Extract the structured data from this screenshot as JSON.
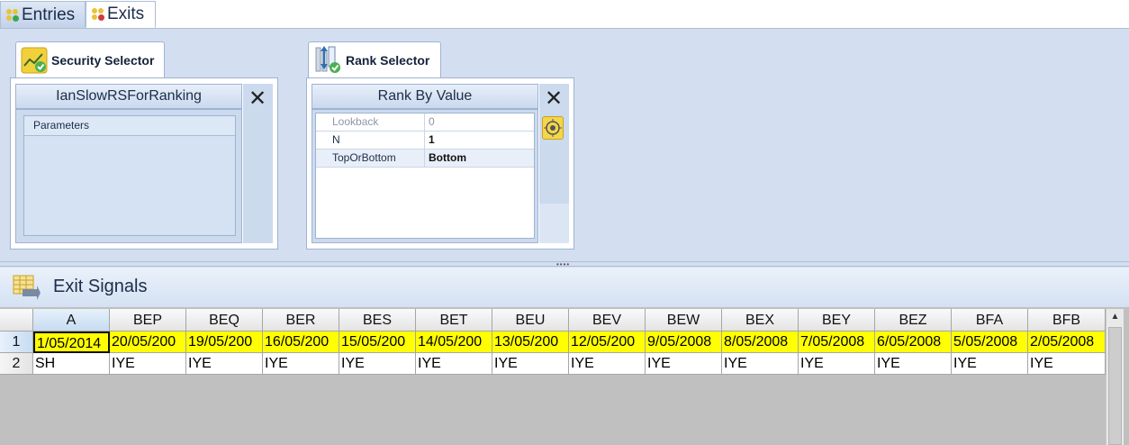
{
  "top_tabs": [
    {
      "label": "Entries"
    },
    {
      "label": "Exits"
    }
  ],
  "security_selector": {
    "tab_label": "Security Selector",
    "header": "IanSlowRSForRanking",
    "params_title": "Parameters"
  },
  "rank_selector": {
    "tab_label": "Rank Selector",
    "header": "Rank By Value",
    "params": [
      {
        "name": "Lookback",
        "value": "0"
      },
      {
        "name": "N",
        "value": "1"
      },
      {
        "name": "TopOrBottom",
        "value": "Bottom"
      }
    ]
  },
  "exit_signals": {
    "title": "Exit Signals"
  },
  "sheet": {
    "columns": [
      "A",
      "BEP",
      "BEQ",
      "BER",
      "BES",
      "BET",
      "BEU",
      "BEV",
      "BEW",
      "BEX",
      "BEY",
      "BEZ",
      "BFA",
      "BFB"
    ],
    "rows": [
      {
        "num": "1",
        "cells": [
          "1/05/2014",
          "20/05/200",
          "19/05/200",
          "16/05/200",
          "15/05/200",
          "14/05/200",
          "13/05/200",
          "12/05/200",
          "9/05/2008",
          "8/05/2008",
          "7/05/2008",
          "6/05/2008",
          "5/05/2008",
          "2/05/2008"
        ]
      },
      {
        "num": "2",
        "cells": [
          "SH",
          "IYE",
          "IYE",
          "IYE",
          "IYE",
          "IYE",
          "IYE",
          "IYE",
          "IYE",
          "IYE",
          "IYE",
          "IYE",
          "IYE",
          "IYE"
        ]
      }
    ]
  },
  "colors": {
    "highlight": "#ffff00",
    "accent": "#d3dff0"
  }
}
